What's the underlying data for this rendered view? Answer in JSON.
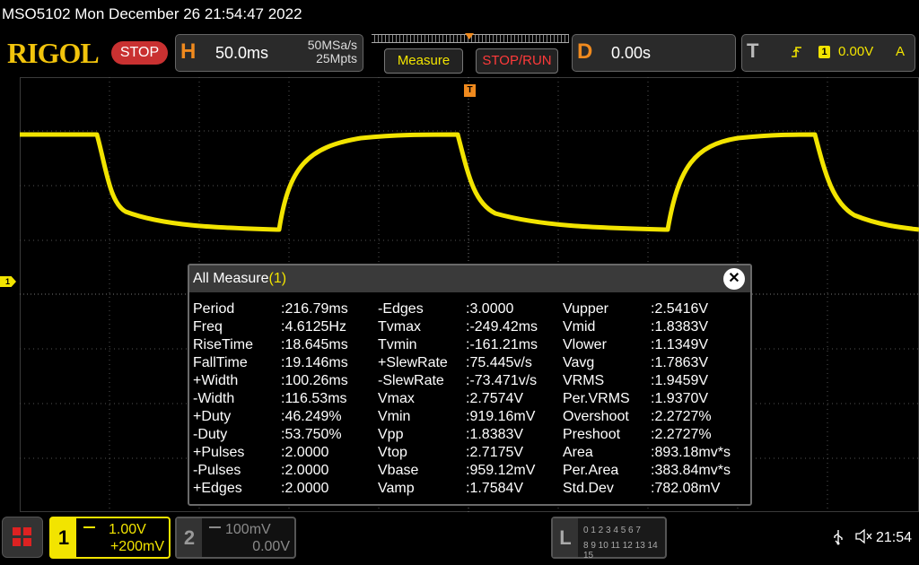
{
  "window": {
    "title": "MSO5102  Mon December 26 21:54:47 2022"
  },
  "toolbar": {
    "logo": "RIGOL",
    "run_state": "STOP",
    "horizontal": {
      "letter": "H",
      "timebase": "50.0ms",
      "sample_rate": "50MSa/s",
      "memory_depth": "25Mpts"
    },
    "measure_button": "Measure",
    "stop_run_button": "STOP/RUN",
    "delay": {
      "letter": "D",
      "value": "0.00s"
    },
    "trigger": {
      "letter": "T",
      "source": "1",
      "level": "0.00V",
      "mode": "A",
      "edge_icon": "rising-edge-icon"
    }
  },
  "screen": {
    "trigger_position_marker": "T",
    "channel1_marker": "1",
    "trace_color": "#f2e400"
  },
  "measurements": {
    "title": "All Measure",
    "count": "(1)",
    "columns": [
      [
        {
          "label": "Period",
          "value": ":216.79ms"
        },
        {
          "label": "Freq",
          "value": ":4.6125Hz"
        },
        {
          "label": "RiseTime",
          "value": ":18.645ms"
        },
        {
          "label": "FallTime",
          "value": ":19.146ms"
        },
        {
          "label": "+Width",
          "value": ":100.26ms"
        },
        {
          "label": "-Width",
          "value": ":116.53ms"
        },
        {
          "label": "+Duty",
          "value": ":46.249%"
        },
        {
          "label": "-Duty",
          "value": ":53.750%"
        },
        {
          "label": "+Pulses",
          "value": ":2.0000"
        },
        {
          "label": "-Pulses",
          "value": ":2.0000"
        },
        {
          "label": "+Edges",
          "value": ":2.0000"
        }
      ],
      [
        {
          "label": "-Edges",
          "value": ":3.0000"
        },
        {
          "label": "Tvmax",
          "value": ":-249.42ms"
        },
        {
          "label": "Tvmin",
          "value": ":-161.21ms"
        },
        {
          "label": "+SlewRate",
          "value": ":75.445v/s"
        },
        {
          "label": "-SlewRate",
          "value": ":-73.471v/s"
        },
        {
          "label": "Vmax",
          "value": ":2.7574V"
        },
        {
          "label": "Vmin",
          "value": ":919.16mV"
        },
        {
          "label": "Vpp",
          "value": ":1.8383V"
        },
        {
          "label": "Vtop",
          "value": ":2.7175V"
        },
        {
          "label": "Vbase",
          "value": ":959.12mV"
        },
        {
          "label": "Vamp",
          "value": ":1.7584V"
        }
      ],
      [
        {
          "label": "Vupper",
          "value": ":2.5416V"
        },
        {
          "label": "Vmid",
          "value": ":1.8383V"
        },
        {
          "label": "Vlower",
          "value": ":1.1349V"
        },
        {
          "label": "Vavg",
          "value": ":1.7863V"
        },
        {
          "label": "VRMS",
          "value": ":1.9459V"
        },
        {
          "label": "Per.VRMS",
          "value": ":1.9370V"
        },
        {
          "label": "Overshoot",
          "value": ":2.2727%"
        },
        {
          "label": "Preshoot",
          "value": ":2.2727%"
        },
        {
          "label": "Area",
          "value": ":893.18mv*s"
        },
        {
          "label": "Per.Area",
          "value": ":383.84mv*s"
        },
        {
          "label": "Std.Dev",
          "value": ":782.08mV"
        }
      ]
    ]
  },
  "bottom": {
    "channel1": {
      "number": "1",
      "scale": "1.00V",
      "offset": "+200mV"
    },
    "channel2": {
      "number": "2",
      "scale": "100mV",
      "offset": "0.00V"
    },
    "logic": {
      "letter": "L",
      "row1": "0 1 2 3   4 5 6 7",
      "row2": "8 9 10 11 12 13 14 15"
    },
    "clock": "21:54"
  }
}
